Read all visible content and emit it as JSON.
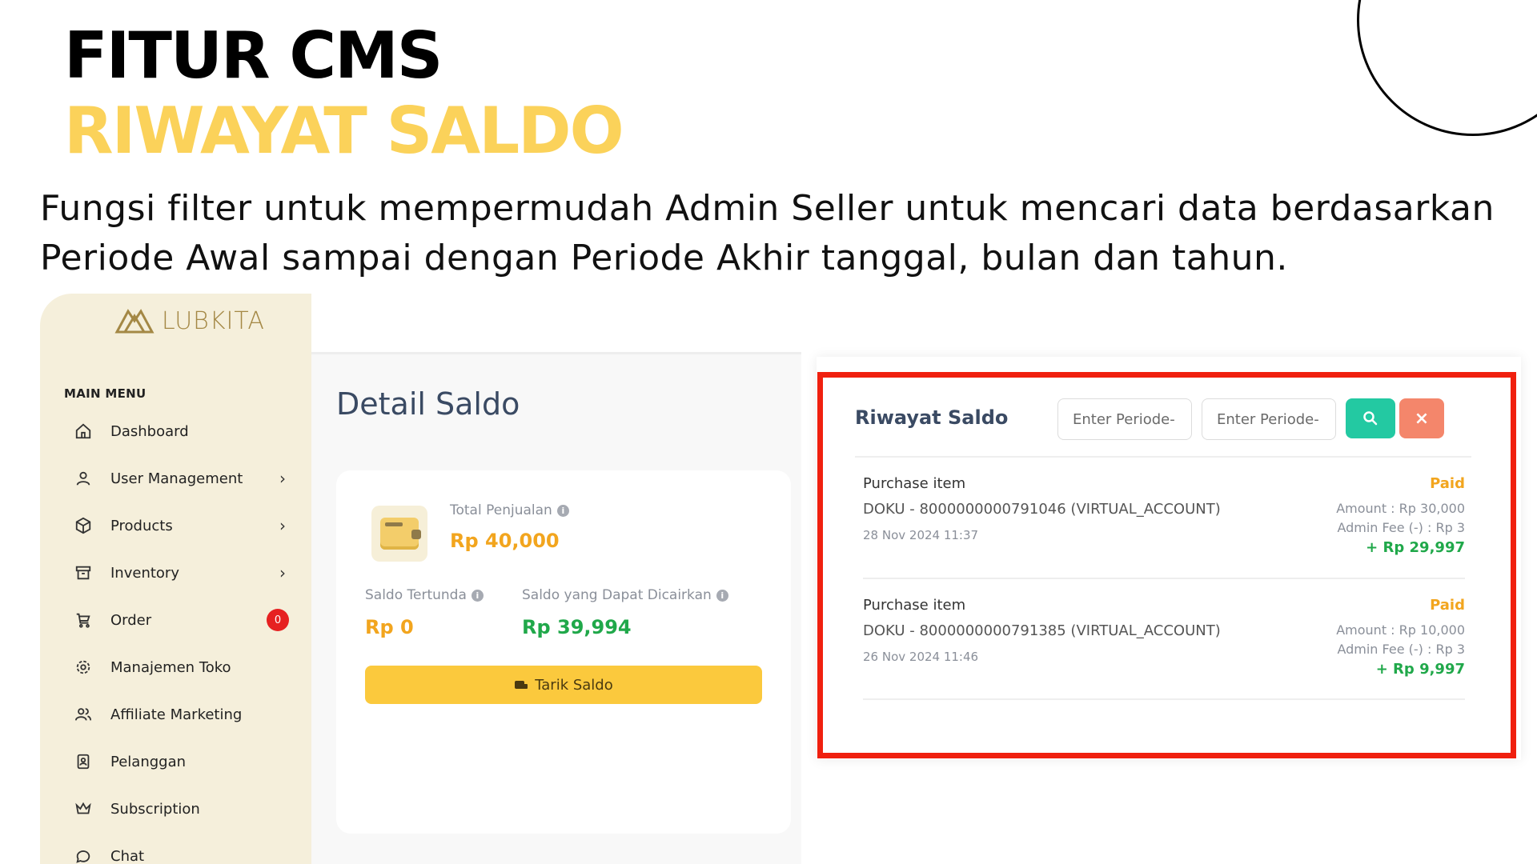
{
  "heading": {
    "line1": "FITUR CMS",
    "line2": "RIWAYAT SALDO",
    "description": "Fungsi filter untuk mempermudah Admin Seller untuk mencari data berdasarkan Periode Awal sampai dengan Periode Akhir tanggal, bulan dan tahun."
  },
  "colors": {
    "accent_yellow": "#fbd25a",
    "sidebar_bg": "#f5efdb",
    "paid_orange": "#f2a51e",
    "positive_green": "#20a84a",
    "search_teal": "#23c9a2",
    "clear_coral": "#f4866b",
    "highlight_red": "#f0200f"
  },
  "sidebar": {
    "logo_text": "LUBKITA",
    "menu_heading": "MAIN MENU",
    "items": [
      {
        "label": "Dashboard",
        "icon": "home-icon"
      },
      {
        "label": "User Management",
        "icon": "user-icon",
        "chevron": "›"
      },
      {
        "label": "Products",
        "icon": "box-icon",
        "chevron": "›"
      },
      {
        "label": "Inventory",
        "icon": "archive-icon",
        "chevron": "›"
      },
      {
        "label": "Order",
        "icon": "cart-icon",
        "badge": "0"
      },
      {
        "label": "Manajemen Toko",
        "icon": "gear-icon"
      },
      {
        "label": "Affiliate Marketing",
        "icon": "users-icon"
      },
      {
        "label": "Pelanggan",
        "icon": "contact-icon"
      },
      {
        "label": "Subscription",
        "icon": "crown-icon"
      },
      {
        "label": "Chat",
        "icon": "chat-icon"
      }
    ]
  },
  "detail": {
    "title": "Detail Saldo",
    "total_label": "Total Penjualan",
    "total_value": "Rp 40,000",
    "tertunda_label": "Saldo Tertunda",
    "tertunda_value": "Rp 0",
    "cair_label": "Saldo yang Dapat Dicairkan",
    "cair_value": "Rp 39,994",
    "tarik_label": "Tarik Saldo",
    "info_glyph": "i"
  },
  "riwayat": {
    "title": "Riwayat Saldo",
    "periode_awal_placeholder": "Enter Periode-",
    "periode_akhir_placeholder": "Enter Periode-",
    "clear_glyph": "×",
    "transactions": [
      {
        "type": "Purchase item",
        "reference": "DOKU - 8000000000791046 (VIRTUAL_ACCOUNT)",
        "date": "28 Nov 2024 11:37",
        "status": "Paid",
        "amount": "Amount : Rp 30,000",
        "fee": "Admin Fee (-) : Rp 3",
        "net": "+ Rp 29,997"
      },
      {
        "type": "Purchase item",
        "reference": "DOKU - 8000000000791385 (VIRTUAL_ACCOUNT)",
        "date": "26 Nov 2024 11:46",
        "status": "Paid",
        "amount": "Amount : Rp 10,000",
        "fee": "Admin Fee (-) : Rp 3",
        "net": "+ Rp 9,997"
      }
    ]
  }
}
